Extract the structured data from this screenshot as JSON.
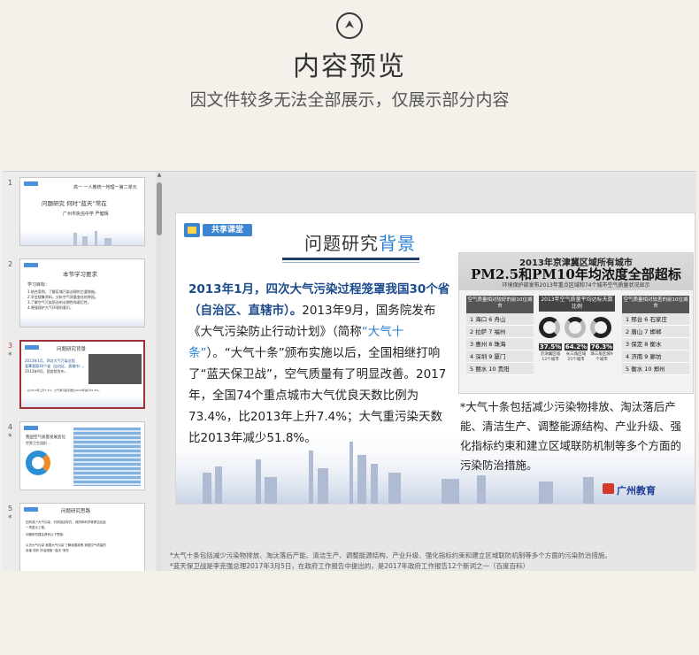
{
  "header": {
    "title": "内容预览",
    "subtitle": "因文件较多无法全部展示，仅展示部分内容",
    "icon": "chevron-up-circle-icon"
  },
  "sidebar": {
    "slides": [
      {
        "num": "1",
        "lines": [
          "高一 一人教统一地理一第二单元",
          "问题研究    何时“蓝天”常在",
          "广州市执信中学  严健辉"
        ]
      },
      {
        "num": "2",
        "lines": [
          "本节学习要求",
          "学习目标：",
          "1.结合案例，了解区域污染治理的主要措施。",
          "2.学会搜集资料，分析空气质量变化的原因。",
          "3.了解空气污染防治的长期性和艰巨性。",
          "4.增强保护大气环境的意识。"
        ]
      },
      {
        "num": "3",
        "star": "*",
        "lines": [
          "问题研究背景",
          "2013年1月，四次大气污染过程",
          "笼罩我国30个省（自治区、直辖市）。",
          "2013年9月，国务院发布…",
          "…比2013年上升7.4%；大气重污染天数比2013年减少51.8%。"
        ]
      },
      {
        "num": "4",
        "star": "*",
        "lines": [
          "我国空气质量发展变化",
          "世界卫生组织…"
        ]
      },
      {
        "num": "5",
        "star": "*",
        "lines": [
          "问题研究思路",
          "如何减少大气污染，仍然挑战存在，政府和科学家是否如此",
          "一项重大工程。",
          "问题研究建议具有以下思路：",
          "认识大气污染    我国大气污染    了解我国政策    我国空气质量的",
          "危害            现状              防治措施    “蓝天”常在"
        ]
      }
    ]
  },
  "slide": {
    "logo_text": "共享课堂",
    "title_main": "问题研究",
    "title_accent": "背景",
    "body_bold": "2013年1月，四次大气污染过程笼罩我国30个省（自治区、直辖市）。",
    "body_part1": "2013年9月，国务院发布《大气污染防止行动计划》（简称",
    "body_quote": "“大气十条”",
    "body_part2": "）。“大气十条”颁布实施以后，全国相继打响了“蓝天保卫战”，空气质量有了明显改善。2017年，全国74个重点城市大气优良天数比例为73.4%，比2013年上升7.4%；大气重污染天数比2013年减少51.8%。",
    "figure": {
      "title_top": "2013年京津冀区域所有城市",
      "title_big": "PM2.5和PM10年均浓度全部超标",
      "subtitle": "环境保护部发布2013年重点区域和74个城市空气质量状况显示",
      "left_header": "空气质量相对较好的前10位城市",
      "left_cities": [
        "1 海口  6 舟山",
        "2 拉萨  7 福州",
        "3 惠州  8 珠海",
        "4 深圳  9 厦门",
        "5 丽水  10 贵阳"
      ],
      "mid_header": "2013年空气质量平均达标天数比例",
      "percents": [
        "37.5%",
        "64.2%",
        "76.3%"
      ],
      "percent_notes": [
        "京津冀区域13个城市",
        "长三角区域25个城市",
        "珠三角区域9个城市"
      ],
      "right_header": "空气质量相对较差的前10位城市",
      "right_cities": [
        "1 邢台  6 石家庄",
        "2 唐山  7 邯郸",
        "3 保定  8 衡水",
        "4 济南  9 廊坊",
        "5 衡水  10 郑州"
      ]
    },
    "note": "*大气十条包括减少污染物排放、淘汰落后产能、清洁生产、调整能源结构、产业升级、强化指标约束和建立区域联防机制等多个方面的污染防治措施。",
    "brand": "广州教育"
  },
  "notes": {
    "line1": "*大气十条包括减少污染物排放、淘汰落后产能、清洁生产、调整能源结构、产业升级、强化指标约束和建立区域联防机制等多个方面的污染防治措施。",
    "line2": "*蓝天保卫战是李克强总理2017年3月5日，在政府工作报告中提出的，是2017年政府工作报告12个新词之一（百度百科）"
  }
}
